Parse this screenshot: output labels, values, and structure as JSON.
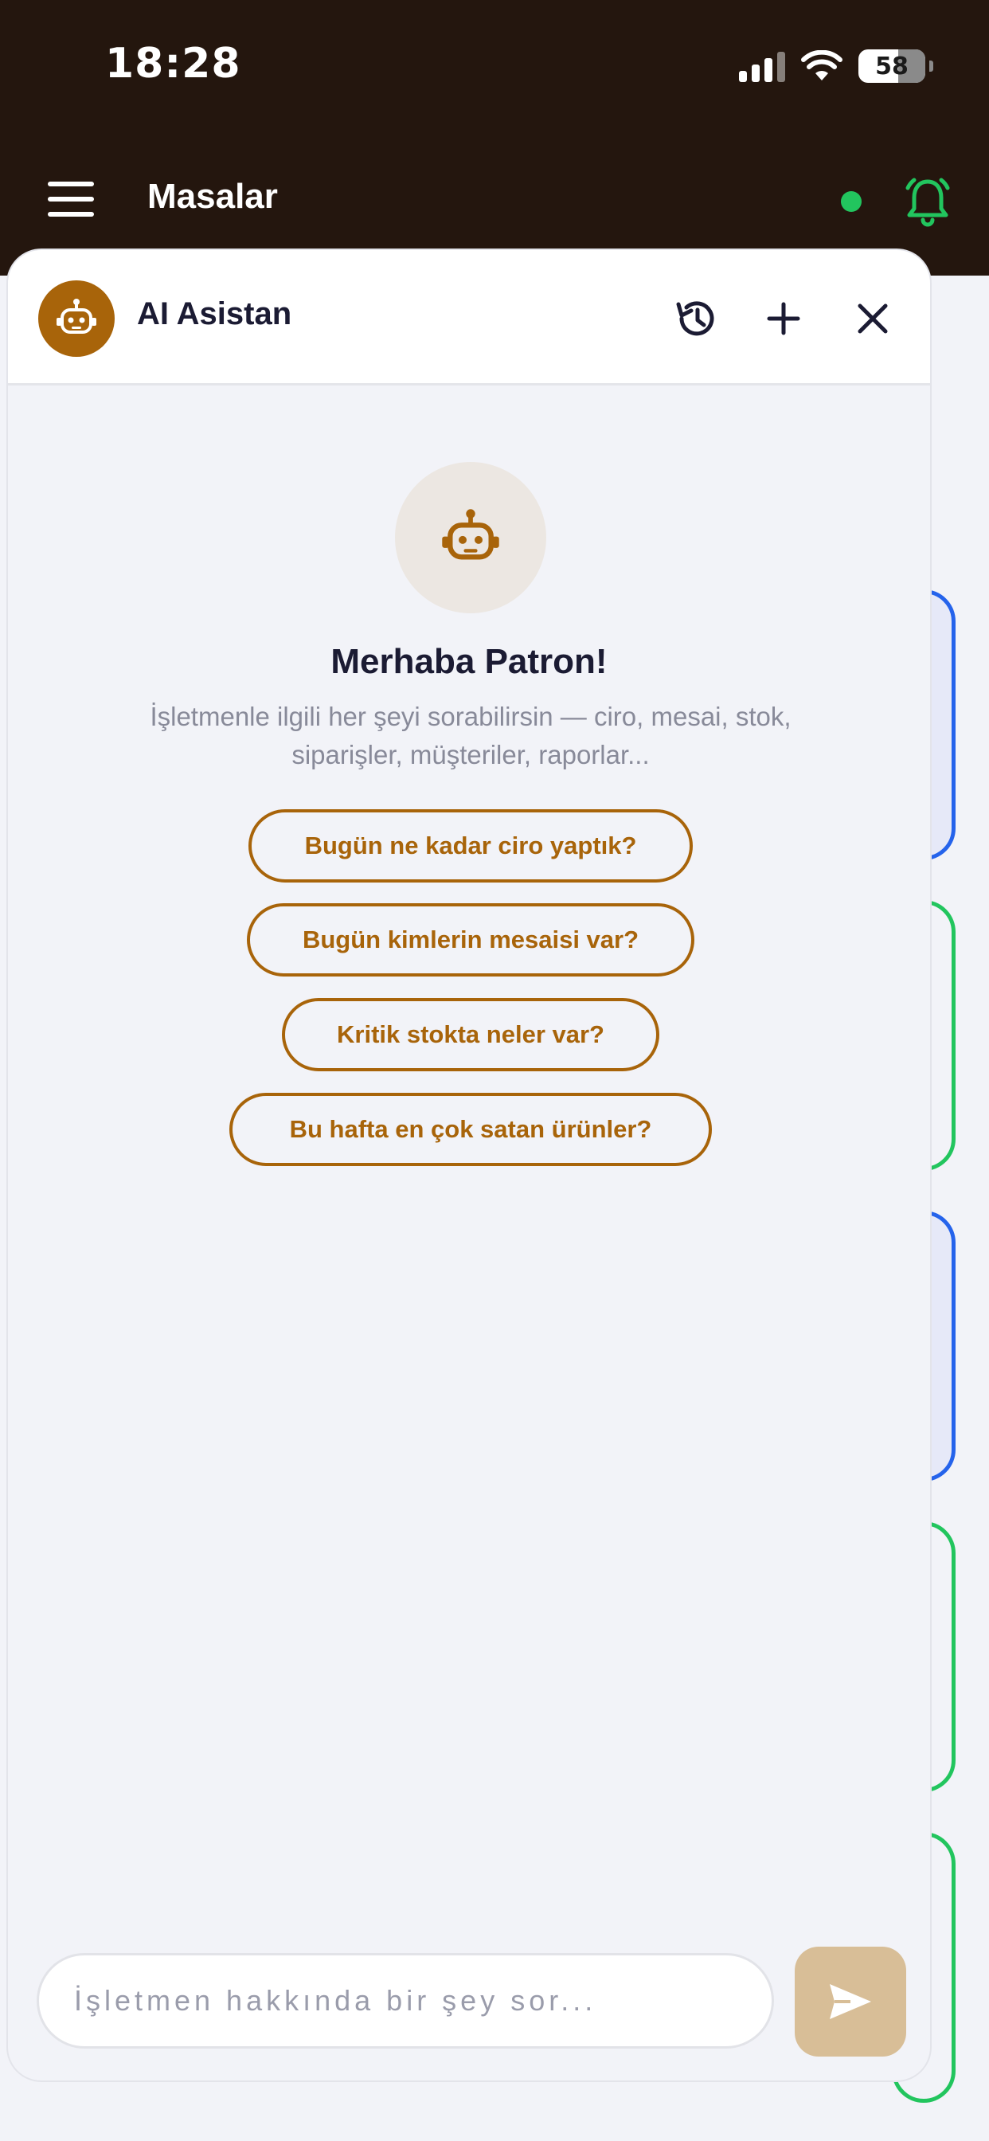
{
  "status": {
    "time": "18:28",
    "battery": "58"
  },
  "appbar": {
    "title": "Masalar"
  },
  "assistant": {
    "title": "AI Asistan",
    "welcome": "Merhaba Patron!",
    "subtitle": "İşletmenle ilgili her şeyi sorabilirsin — ciro, mesai, stok, siparişler, müşteriler, raporlar...",
    "suggestions": [
      "Bugün ne kadar ciro yaptık?",
      "Bugün kimlerin mesaisi var?",
      "Kritik stokta neler var?",
      "Bu hafta en çok satan ürünler?"
    ],
    "input_placeholder": "İşletmen hakkında bir şey sor..."
  },
  "colors": {
    "topbar": "#24160e",
    "accent": "#a8640a",
    "online": "#22c55e",
    "send_button": "#d8be97",
    "card_blue": "#2563eb",
    "card_green": "#22c55e"
  }
}
